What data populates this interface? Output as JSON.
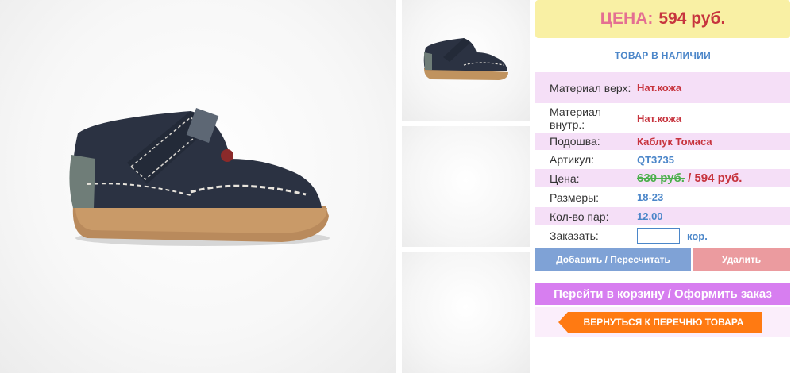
{
  "header": {
    "price_label": "ЦЕНА:",
    "price_value": "594 руб."
  },
  "stock_status": "ТОВАР В НАЛИЧИИ",
  "specs": {
    "material_top": {
      "label": "Материал верх:",
      "value": "Нат.кожа"
    },
    "material_inner": {
      "label": "Материал внутр.:",
      "value": "Нат.кожа"
    },
    "sole": {
      "label": "Подошва:",
      "value": "Каблук Томаса"
    },
    "article": {
      "label": "Артикул:",
      "value": "QT3735"
    },
    "price": {
      "label": "Цена:",
      "old": "630 руб.",
      "separator": " / ",
      "new": "594 руб."
    },
    "sizes": {
      "label": "Размеры:",
      "value": "18-23"
    },
    "pairs": {
      "label": "Кол-во пар:",
      "value": "12,00"
    },
    "order": {
      "label": "Заказать:",
      "input_value": "",
      "unit": "кор."
    }
  },
  "buttons": {
    "add": "Добавить / Пересчитать",
    "delete": "Удалить",
    "cart": "Перейти в корзину / Оформить заказ",
    "back": "ВЕРНУТЬСЯ К ПЕРЕЧНЮ ТОВАРА"
  },
  "colors": {
    "banner_bg": "#f9f0a4",
    "accent_blue": "#4b86c9",
    "accent_red": "#c7343e",
    "accent_green": "#4cb04c",
    "row_pink": "#f5dff7",
    "cart_purple": "#d77ef0",
    "back_orange": "#ff7a12"
  },
  "images": {
    "main": "shoe-photo-large",
    "thumbnails": [
      "shoe-thumbnail",
      "empty-thumbnail",
      "empty-thumbnail"
    ]
  }
}
